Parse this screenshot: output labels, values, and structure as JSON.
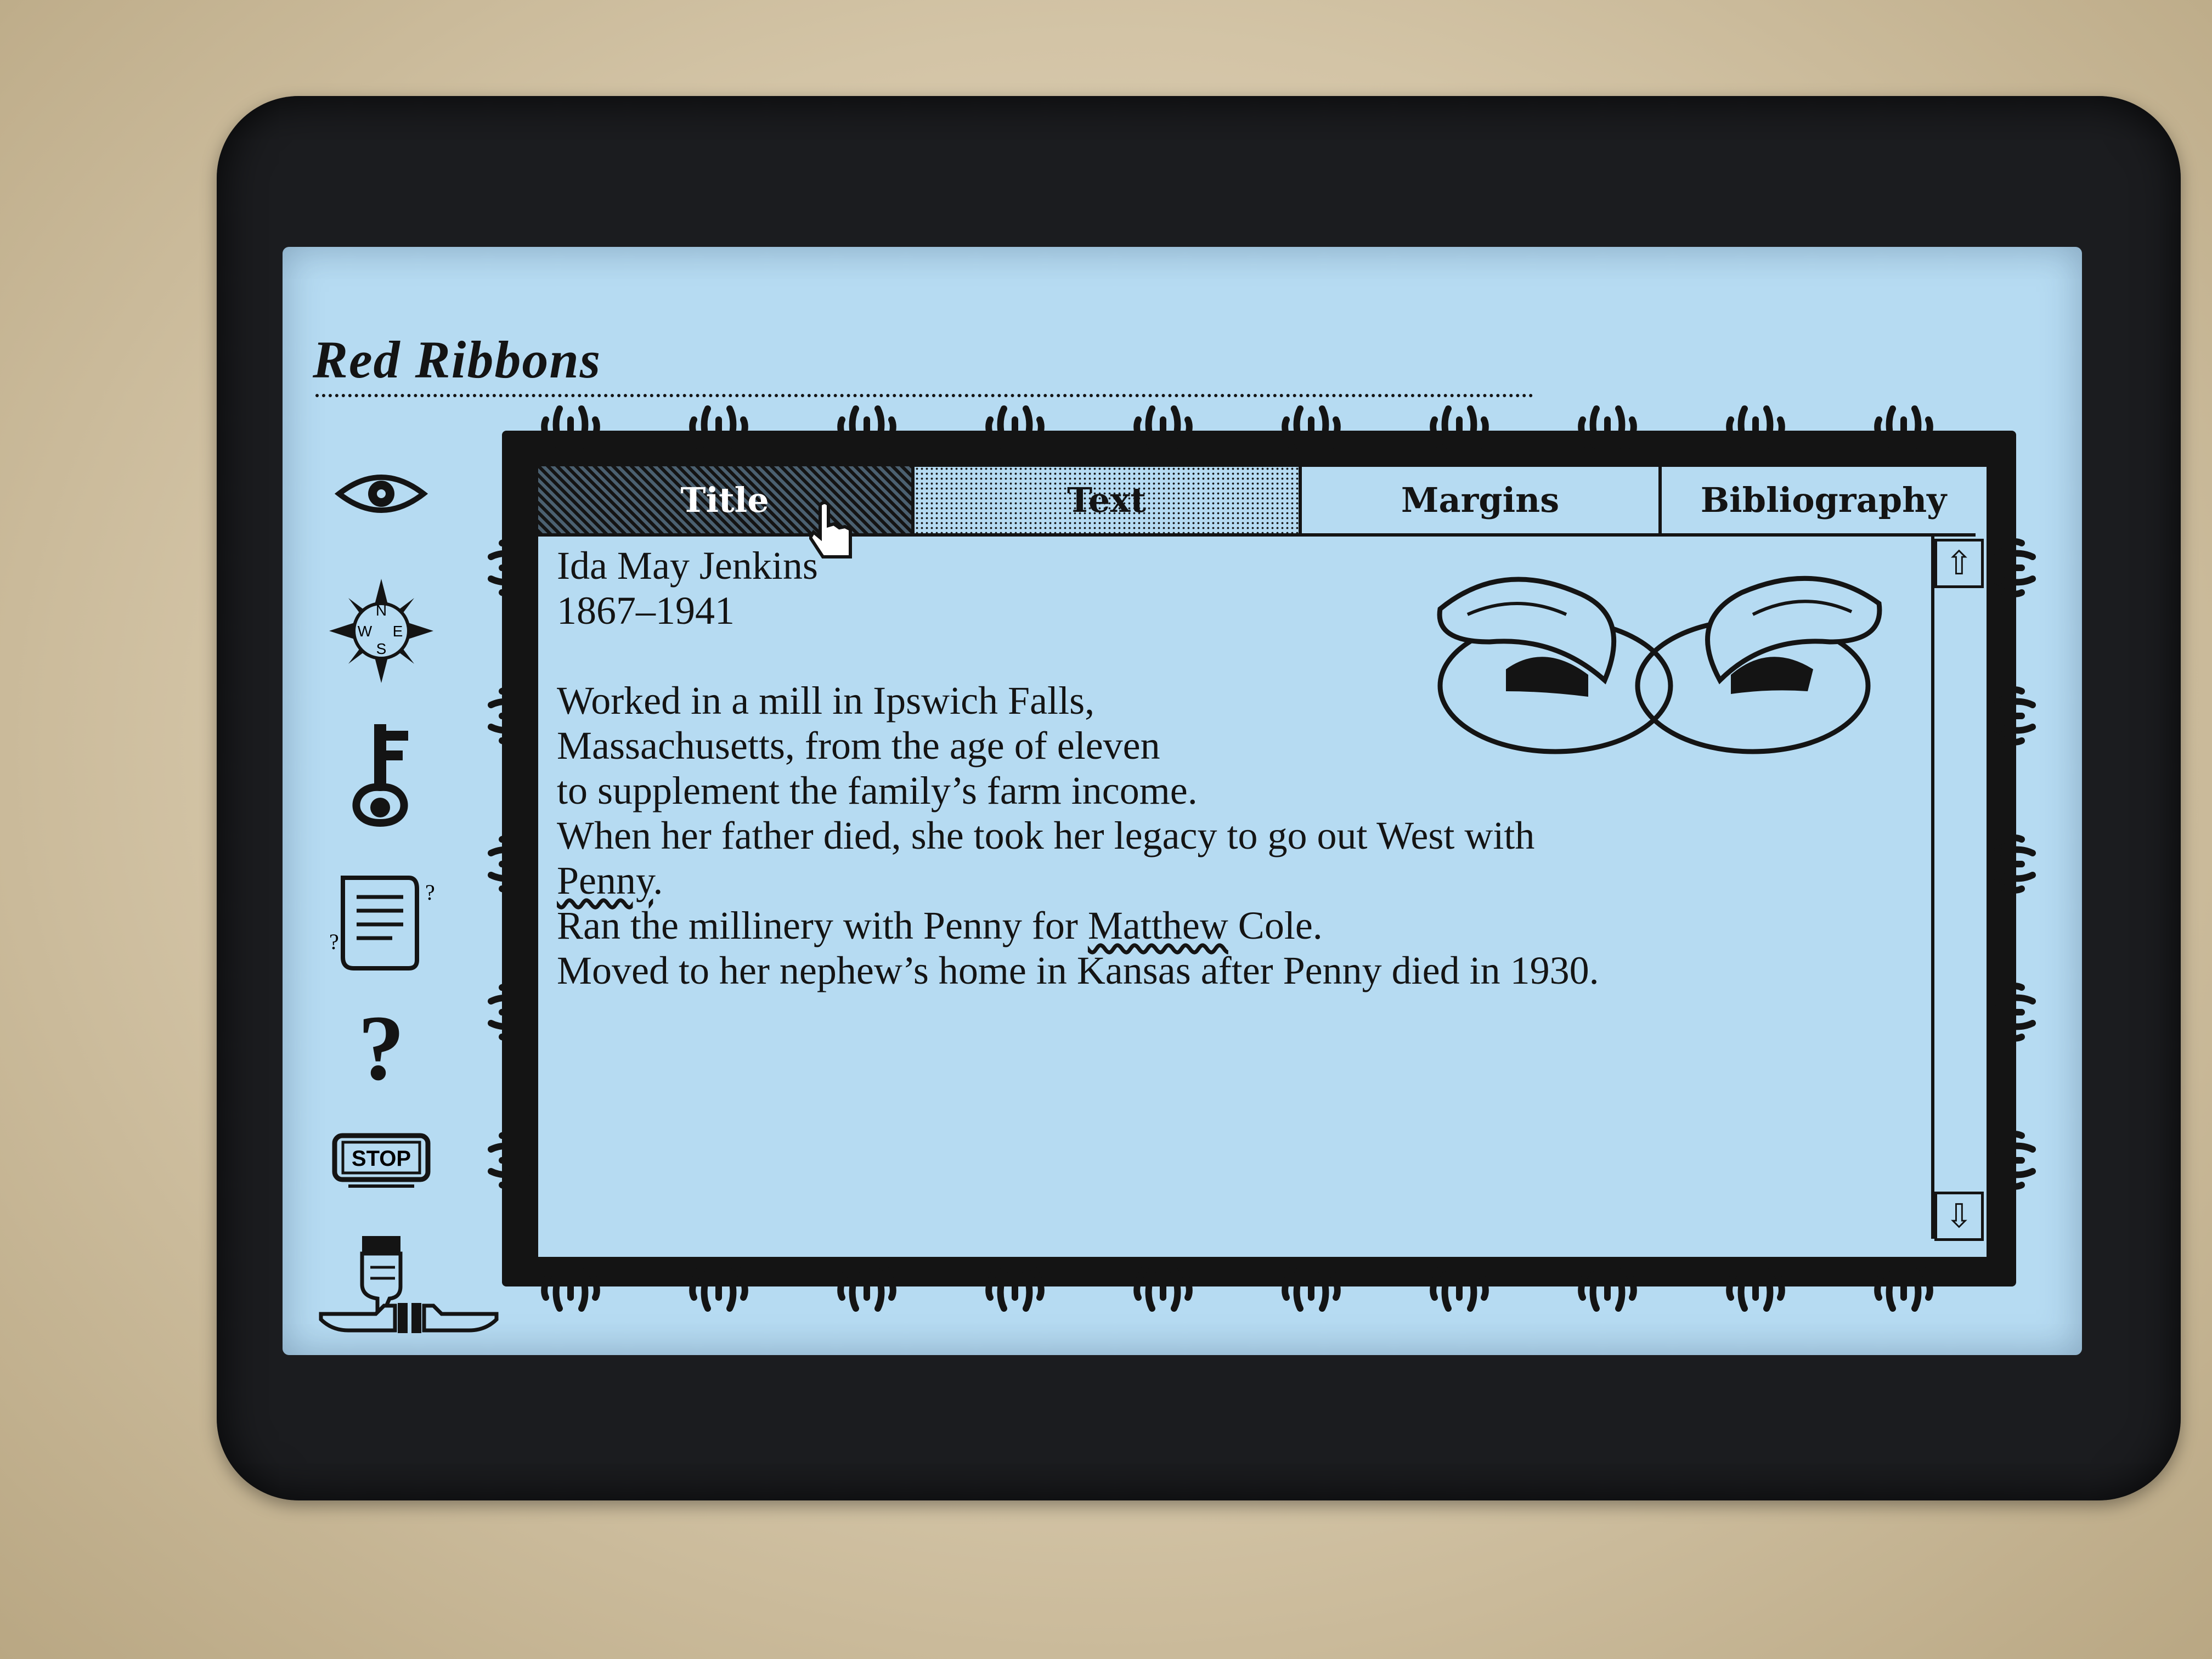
{
  "app": {
    "title": "Red Ribbons"
  },
  "toolbar": {
    "stop_label": "STOP",
    "help_label": "?",
    "compass": {
      "north": "N",
      "west": "W",
      "south": "S",
      "east": "E"
    },
    "tools": [
      "eye-icon",
      "compass-icon",
      "key-icon",
      "scroll-icon",
      "question-mark-icon",
      "stop-sign-icon",
      "pointing-hand-icon",
      "hands-icon"
    ]
  },
  "tabs": [
    {
      "label": "Title",
      "state": "active"
    },
    {
      "label": "Text",
      "state": "selected-pattern"
    },
    {
      "label": "Margins",
      "state": "normal"
    },
    {
      "label": "Bibliography",
      "state": "normal"
    }
  ],
  "document": {
    "name_line": "Ida May Jenkins",
    "dates_line": "1867–1941",
    "paragraph": {
      "line1": "Worked in a mill in Ipswich Falls,",
      "line2": "Massachusetts, from the age of eleven",
      "line3": "to supplement the family’s farm income.",
      "line4": "When her father died, she took her legacy to go out West with",
      "line5_link": "Penny",
      "line5_suffix": ".",
      "line6_prefix": "Ran the millinery with Penny for ",
      "line6_link": "Matthew",
      "line6_suffix": " Cole.",
      "line7": "Moved to her nephew’s home in Kansas after Penny died in 1930."
    }
  },
  "scrollbar": {
    "up_icon": "⇧",
    "down_icon": "⇩"
  },
  "colors": {
    "screen": "#b6dbf2",
    "ink": "#141414",
    "bezel": "#1b1c1f",
    "case": "#d6c8ae"
  }
}
